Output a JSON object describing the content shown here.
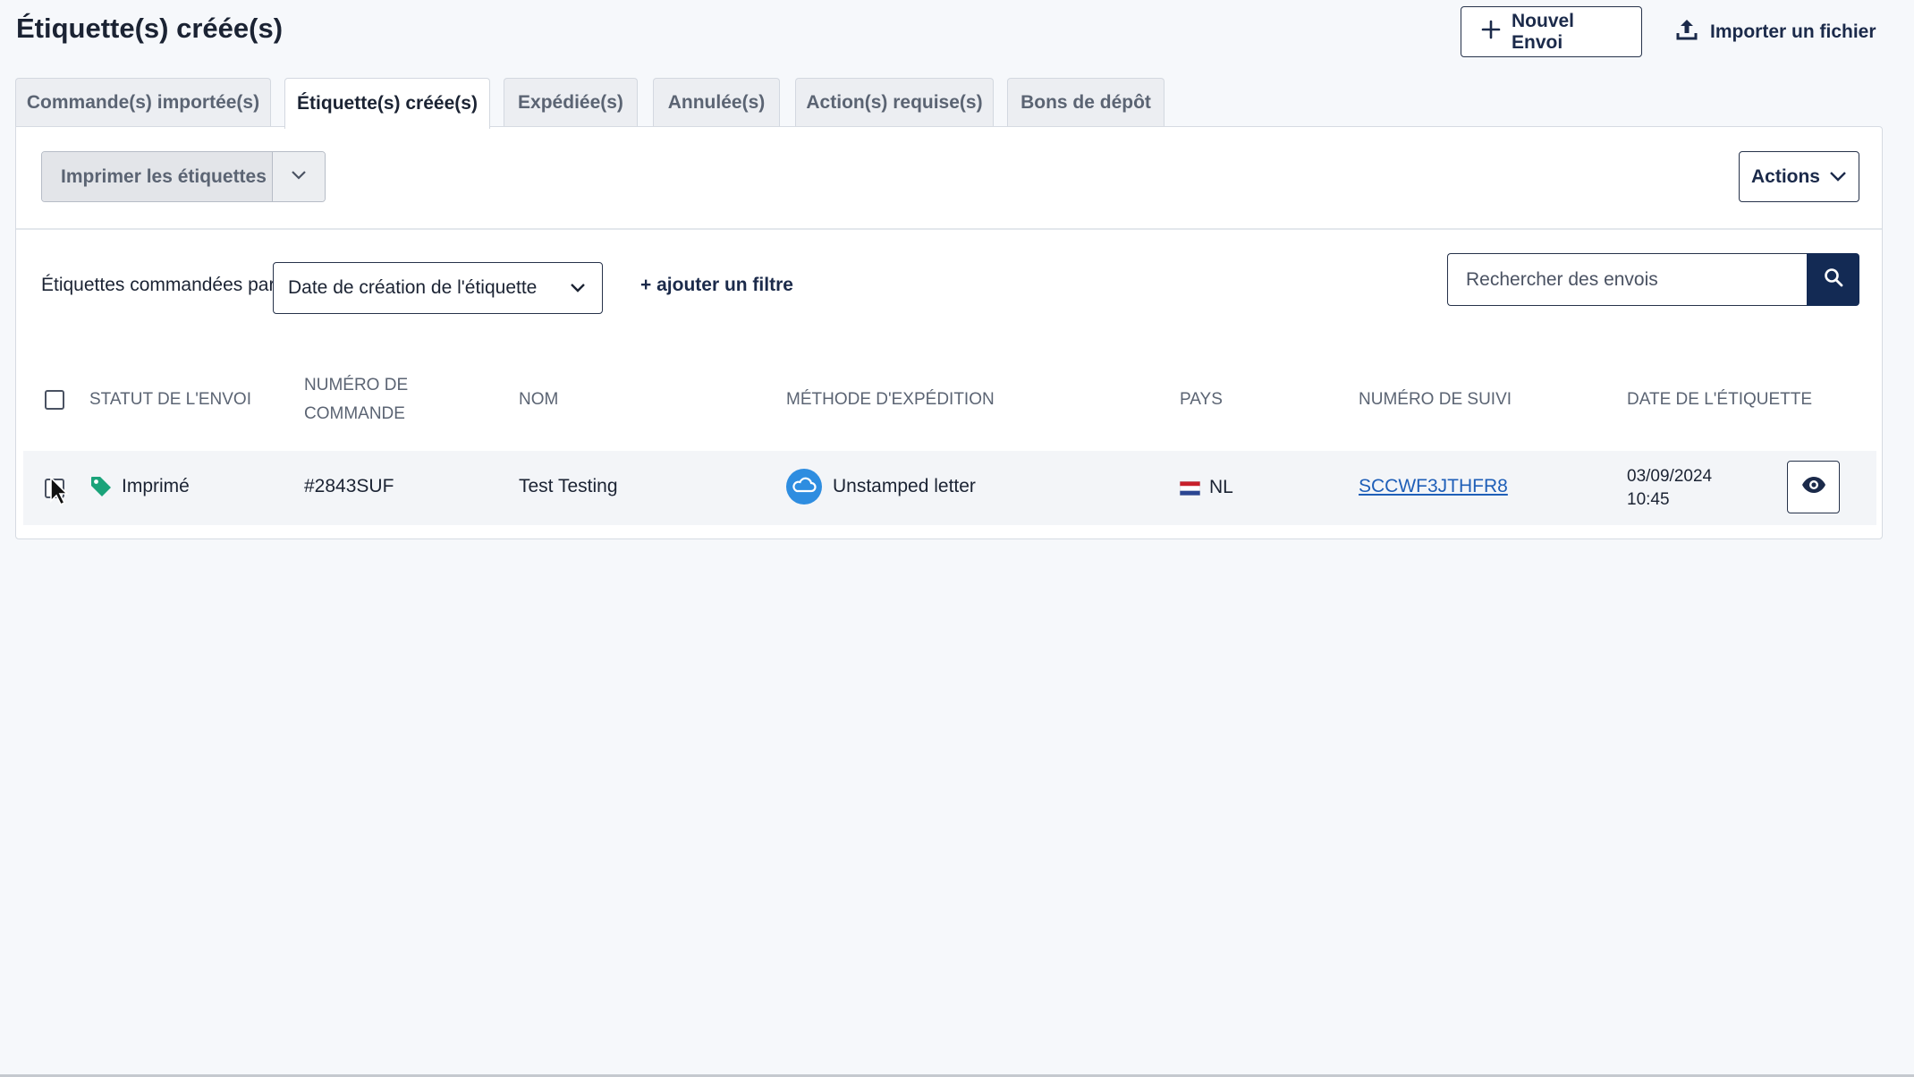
{
  "page": {
    "title": "Étiquette(s) créée(s)"
  },
  "header": {
    "new_shipment": "Nouvel Envoi",
    "import_file": "Importer un fichier"
  },
  "tabs": [
    {
      "label": "Commande(s) importée(s)",
      "active": false
    },
    {
      "label": "Étiquette(s) créée(s)",
      "active": true
    },
    {
      "label": "Expédiée(s)",
      "active": false
    },
    {
      "label": "Annulée(s)",
      "active": false
    },
    {
      "label": "Action(s) requise(s)",
      "active": false
    },
    {
      "label": "Bons de dépôt",
      "active": false
    }
  ],
  "toolbar": {
    "print_labels": "Imprimer les étiquettes",
    "actions": "Actions"
  },
  "filters": {
    "sort_label": "Étiquettes commandées par",
    "sort_value": "Date de création de l'étiquette",
    "add_filter": "+ ajouter un filtre",
    "search_placeholder": "Rechercher des envois"
  },
  "table": {
    "columns": {
      "status": "STATUT DE L'ENVOI",
      "order_line1": "NUMÉRO DE",
      "order_line2": "COMMANDE",
      "name": "NOM",
      "method": "MÉTHODE D'EXPÉDITION",
      "country": "PAYS",
      "tracking": "NUMÉRO DE SUIVI",
      "date": "DATE DE L'ÉTIQUETTE"
    },
    "rows": [
      {
        "status": "Imprimé",
        "order": "#2843SUF",
        "name": "Test Testing",
        "method": "Unstamped letter",
        "country": "NL",
        "tracking": "SCCWF3JTHFR8",
        "date": "03/09/2024",
        "time": "10:45"
      }
    ]
  },
  "icons": {
    "status_tag": "tag-icon",
    "method": "cloud-icon",
    "flag": "netherlands-flag-icon",
    "view": "eye-icon"
  },
  "colors": {
    "accent": "#132a54",
    "status_green": "#1aa37a",
    "method_blue": "#2e8de0",
    "link": "#1f5fb8"
  }
}
